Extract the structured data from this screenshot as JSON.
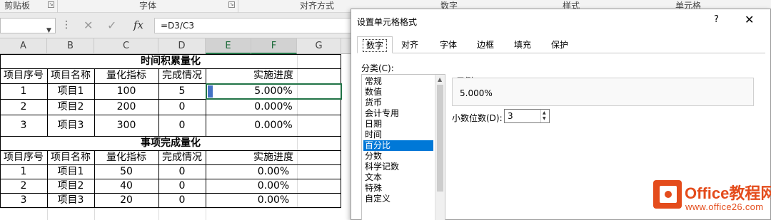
{
  "ribbon": {
    "groups": [
      "剪贴板",
      "字体",
      "对齐方式",
      "数字",
      "样式",
      "单元格"
    ]
  },
  "formula_bar": {
    "name_box": "",
    "cancel_icon": "close-x-icon",
    "enter_icon": "check-icon",
    "fx_label": "fx",
    "formula": "=D3/C3"
  },
  "sheet": {
    "columns": [
      "A",
      "B",
      "C",
      "D",
      "E",
      "F",
      "G"
    ],
    "table1": {
      "title": "时间积累量化",
      "headers": [
        "项目序号",
        "项目名称",
        "量化指标",
        "完成情况",
        "实施进度"
      ],
      "rows": [
        [
          "1",
          "项目1",
          "100",
          "5",
          "5.000%"
        ],
        [
          "2",
          "项目2",
          "200",
          "0",
          "0.000%"
        ],
        [
          "3",
          "项目3",
          "300",
          "0",
          "0.000%"
        ]
      ]
    },
    "table2": {
      "title": "事项完成量化",
      "headers": [
        "项目序号",
        "项目名称",
        "量化指标",
        "完成情况",
        "实施进度"
      ],
      "rows": [
        [
          "1",
          "项目1",
          "50",
          "0",
          "0.00%"
        ],
        [
          "2",
          "项目2",
          "40",
          "0",
          "0.00%"
        ],
        [
          "3",
          "项目3",
          "20",
          "0",
          "0.00%"
        ]
      ]
    }
  },
  "dialog": {
    "title": "设置单元格格式",
    "help": "?",
    "close": "✕",
    "tabs": [
      "数字",
      "对齐",
      "字体",
      "边框",
      "填充",
      "保护"
    ],
    "active_tab": "数字",
    "category_label": "分类(C):",
    "categories": [
      "常规",
      "数值",
      "货币",
      "会计专用",
      "日期",
      "时间",
      "百分比",
      "分数",
      "科学记数",
      "文本",
      "特殊",
      "自定义"
    ],
    "selected_category": "百分比",
    "sample_label": "示例",
    "sample_value": "5.000%",
    "decimal_label": "小数位数(D):",
    "decimal_value": "3"
  },
  "watermark": {
    "title": "Office教程网",
    "url": "www.office26.com"
  },
  "colors": {
    "excel_green": "#217346",
    "selection_blue": "#0078d7",
    "watermark_orange": "#e44c1c"
  }
}
